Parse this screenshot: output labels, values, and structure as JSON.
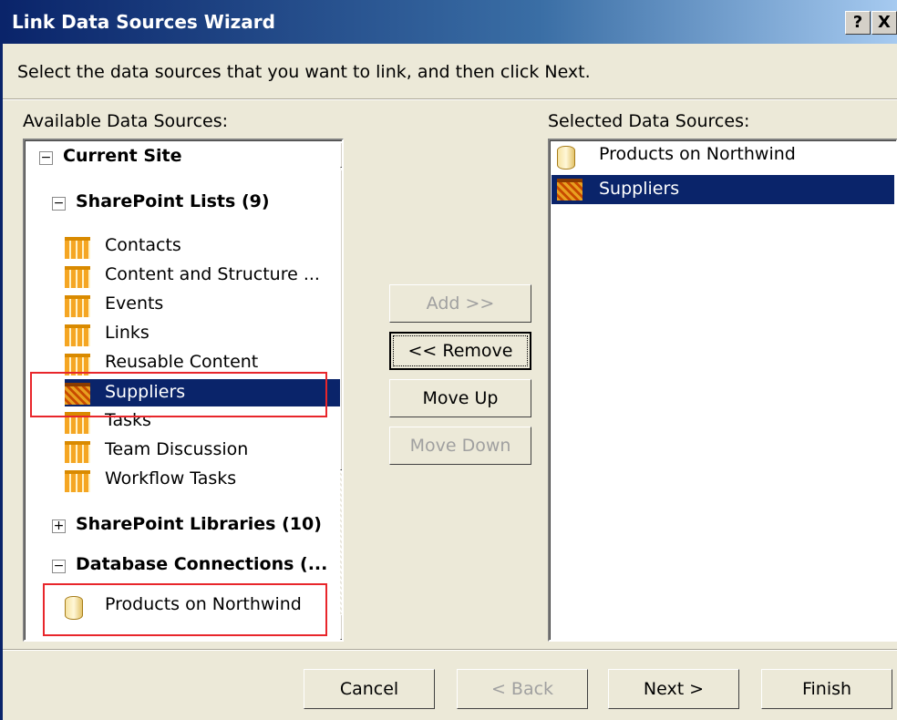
{
  "window": {
    "title": "Link Data Sources Wizard",
    "help_label": "?",
    "close_label": "X"
  },
  "instruction": "Select the data sources that you want to link, and then click Next.",
  "available": {
    "label": "Available Data Sources:",
    "tree": {
      "current_site": "Current Site",
      "sharepoint_lists": "SharePoint Lists (9)",
      "lists": [
        "Contacts",
        "Content and Structure ...",
        "Events",
        "Links",
        "Reusable Content",
        "Suppliers",
        "Tasks",
        "Team Discussion",
        "Workflow Tasks"
      ],
      "sharepoint_libraries": "SharePoint Libraries (10)",
      "database_connections": "Database Connections (...",
      "db_items": [
        "Products on Northwind"
      ]
    }
  },
  "selected": {
    "label": "Selected Data Sources:",
    "items": [
      "Products on Northwind",
      "Suppliers"
    ]
  },
  "buttons": {
    "add": "Add >>",
    "remove": "<< Remove",
    "move_up": "Move Up",
    "move_down": "Move Down",
    "cancel": "Cancel",
    "back": "< Back",
    "next": "Next >",
    "finish": "Finish"
  },
  "colors": {
    "selection": "#0a246a",
    "highlight_box": "#e8262b",
    "dialog_bg": "#ece9d8"
  }
}
